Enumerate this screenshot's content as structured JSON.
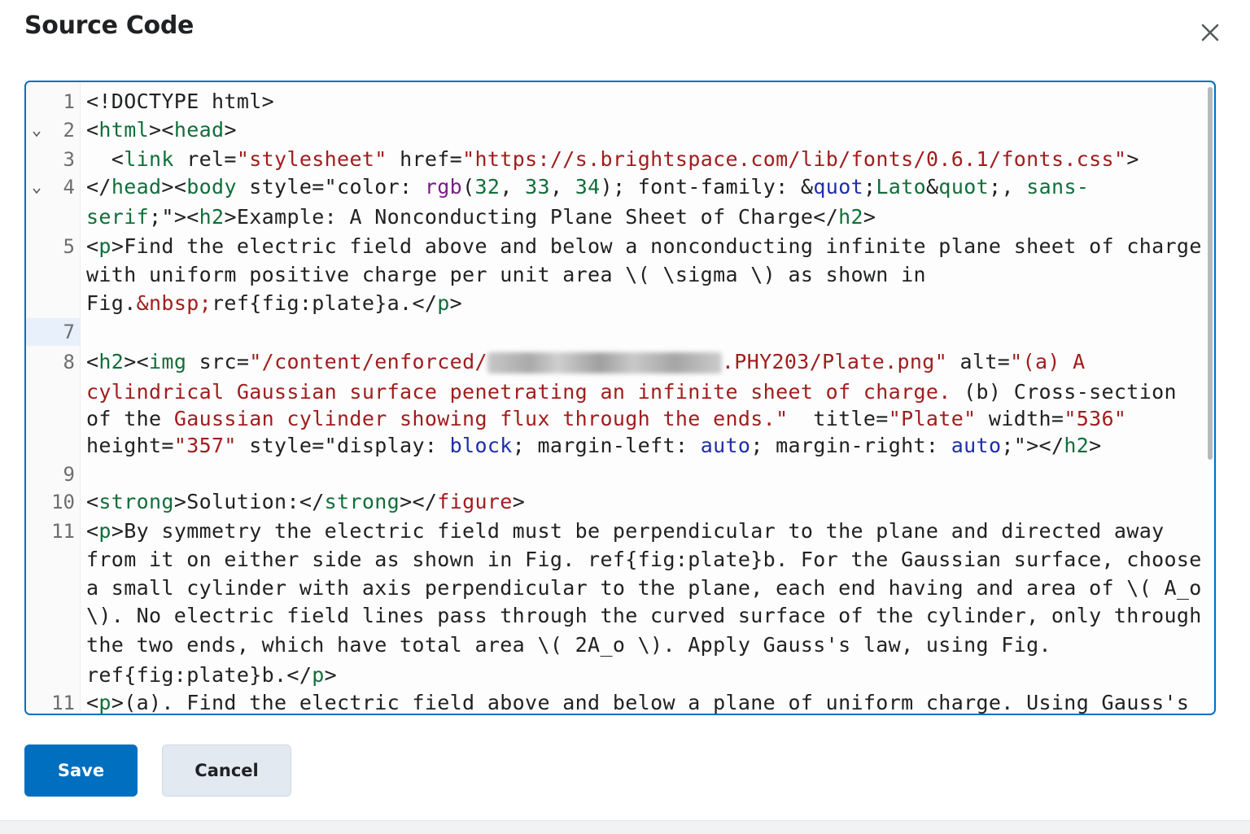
{
  "dialog": {
    "title": "Source Code",
    "close_icon": "close-icon"
  },
  "editor": {
    "line_numbers": [
      "1",
      "2",
      "3",
      "4",
      "5",
      "7",
      "8",
      "9",
      "10",
      "11",
      "11"
    ],
    "lines": {
      "l1": "<!DOCTYPE html>",
      "l2a": "<",
      "l2b": "html",
      "l2c": "><",
      "l2d": "head",
      "l2e": ">",
      "l3a": "  <",
      "l3b": "link",
      "l3c": " rel=",
      "l3d": "\"stylesheet\"",
      "l3e": " href=",
      "l3f": "\"https://s.brightspace.com/lib/fonts/0.6.1/fonts.css\"",
      "l3g": ">",
      "l4a": "</",
      "l4b": "head",
      "l4c": "><",
      "l4d": "body",
      "l4e": " style=\"color: ",
      "l4f": "rgb",
      "l4g": "(",
      "l4h": "32",
      "l4i": ", ",
      "l4j": "33",
      "l4k": ", ",
      "l4l": "34",
      "l4m": "); font-family: &",
      "l4n": "quot",
      "l4o": ";",
      "l4p": "Lato",
      "l4q": "&",
      "l4r": "quot",
      "l4s": ";, ",
      "l4t": "sans-",
      "l4w1": "serif",
      "l4w2": ";\"><",
      "l4w3": "h2",
      "l4w4": ">Example: A Nonconducting Plane Sheet of Charge</",
      "l4w5": "h2",
      "l4w6": ">",
      "l5a": "<",
      "l5b": "p",
      "l5c": ">Find the electric field above and below a nonconducting infinite plane sheet of charge",
      "l5w1": "with uniform positive charge per unit area \\( \\sigma \\) as shown in",
      "l5w2a": "Fig.",
      "l5w2b": "&nbsp;",
      "l5w2c": "ref{fig:plate}a.</",
      "l5w2d": "p",
      "l5w2e": ">",
      "l8a": "<",
      "l8b": "h2",
      "l8c": "><",
      "l8d": "img",
      "l8e": " src=",
      "l8f": "\"/content/enforced/",
      "l8g": ".PHY203/Plate.png\"",
      "l8h": " alt=",
      "l8i": "\"(a) A",
      "l8w1a": "cylindrical Gaussian surface penetrating an infinite sheet of charge.",
      "l8w1b": " (b) Cross-section",
      "l8w2a": "of the ",
      "l8w2b": "Gaussian cylinder showing flux through the ends.\"",
      "l8w2c": "  title=",
      "l8w2d": "\"Plate\"",
      "l8w2e": " width=",
      "l8w2f": "\"536\"",
      "l8w3a": "height=",
      "l8w3b": "\"357\"",
      "l8w3c": " style=\"display: ",
      "l8w3d": "block",
      "l8w3e": "; margin-left: ",
      "l8w3f": "auto",
      "l8w3g": "; margin-right: ",
      "l8w3h": "auto",
      "l8w3i": ";\"></",
      "l8w3j": "h2",
      "l8w3k": ">",
      "l10a": "<",
      "l10b": "strong",
      "l10c": ">Solution:</",
      "l10d": "strong",
      "l10e": "></",
      "l10f": "figure",
      "l10g": ">",
      "l11a": "<",
      "l11b": "p",
      "l11c": ">By symmetry the electric field must be perpendicular to the plane and directed away",
      "l11w1": "from it on either side as shown in Fig. ref{fig:plate}b. For the Gaussian surface, choose",
      "l11w2": "a small cylinder with axis perpendicular to the plane, each end having and area of \\( A_o",
      "l11w3": "\\). No electric field lines pass through the curved surface of the cylinder, only through",
      "l11w4": "the two ends, which have total area \\( 2A_o \\). Apply Gauss's law, using Fig.",
      "l11w5a": "ref{fig:plate}b.</",
      "l11w5b": "p",
      "l11w5c": ">",
      "l12a": "<",
      "l12b": "p",
      "l12c": ">(a). Find the electric field above and below a plane of uniform charge. Using Gauss's"
    }
  },
  "buttons": {
    "save": "Save",
    "cancel": "Cancel"
  },
  "colors": {
    "accent": "#006fbf",
    "tag": "#116e3a",
    "string": "#a11d1d",
    "keyword": "#1d2ea8",
    "function": "#7b1f86"
  }
}
